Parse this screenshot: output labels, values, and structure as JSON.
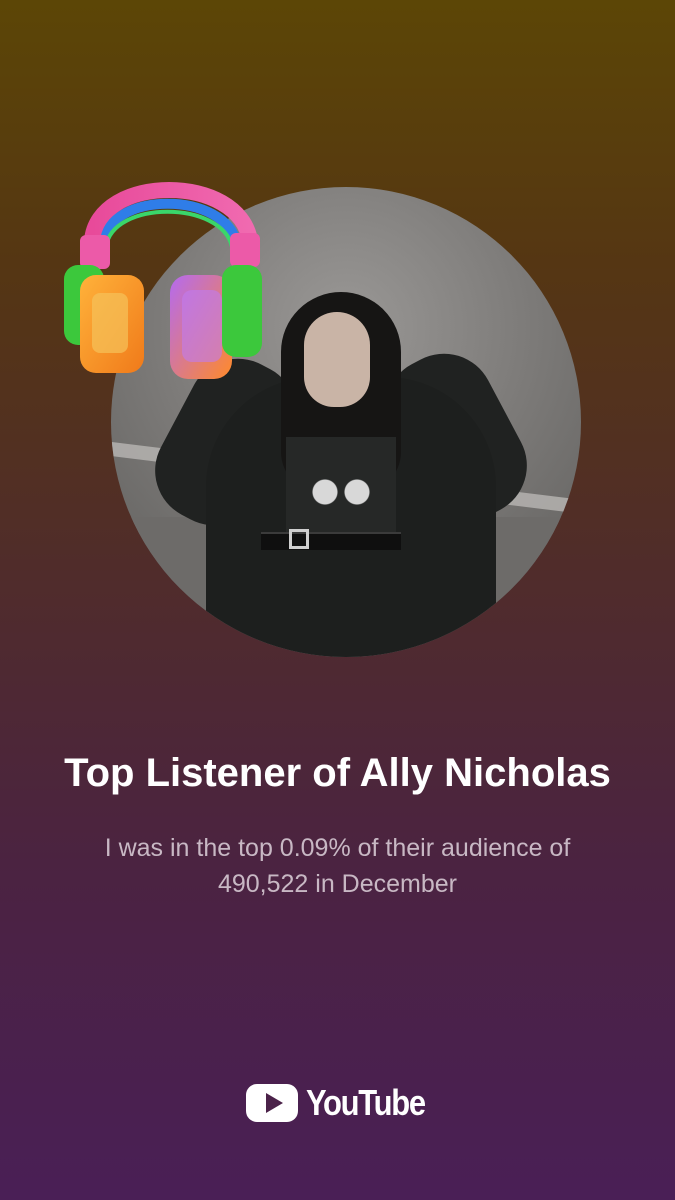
{
  "story": {
    "title": "Top Listener of Ally Nicholas",
    "subtitle": "I was in the top 0.09% of their audience of 490,522 in December"
  },
  "avatar": {
    "icon": "artist-photo"
  },
  "decoration": {
    "icon": "headphones-icon"
  },
  "brand": {
    "name": "YouTube",
    "icon": "youtube-play-icon",
    "accent_color": "#ffffff"
  },
  "colors": {
    "background_top": "#5c4606",
    "background_bottom": "#4a1f56",
    "title": "#ffffff",
    "subtitle": "#c8b8c4"
  }
}
